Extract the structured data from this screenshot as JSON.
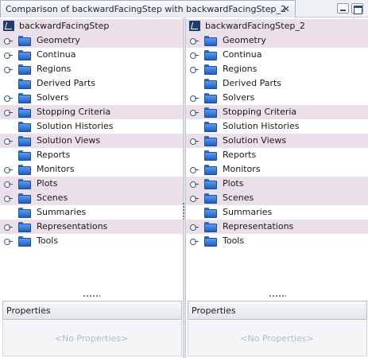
{
  "window": {
    "tab_title": "Comparison of backwardFacingStep with backwardFacingStep_2",
    "close_glyph": "✕"
  },
  "left": {
    "root": "backwardFacingStep",
    "nodes": [
      {
        "label": "Geometry",
        "expandable": true,
        "alt": true
      },
      {
        "label": "Continua",
        "expandable": true,
        "alt": false
      },
      {
        "label": "Regions",
        "expandable": true,
        "alt": false
      },
      {
        "label": "Derived Parts",
        "expandable": false,
        "alt": false
      },
      {
        "label": "Solvers",
        "expandable": true,
        "alt": false
      },
      {
        "label": "Stopping Criteria",
        "expandable": true,
        "alt": true
      },
      {
        "label": "Solution Histories",
        "expandable": false,
        "alt": false
      },
      {
        "label": "Solution Views",
        "expandable": true,
        "alt": true
      },
      {
        "label": "Reports",
        "expandable": false,
        "alt": false
      },
      {
        "label": "Monitors",
        "expandable": true,
        "alt": false
      },
      {
        "label": "Plots",
        "expandable": true,
        "alt": true
      },
      {
        "label": "Scenes",
        "expandable": true,
        "alt": true
      },
      {
        "label": "Summaries",
        "expandable": false,
        "alt": false
      },
      {
        "label": "Representations",
        "expandable": true,
        "alt": true
      },
      {
        "label": "Tools",
        "expandable": true,
        "alt": false
      }
    ],
    "properties_title": "Properties",
    "properties_empty": "<No Properties>"
  },
  "right": {
    "root": "backwardFacingStep_2",
    "nodes": [
      {
        "label": "Geometry",
        "expandable": true,
        "alt": true
      },
      {
        "label": "Continua",
        "expandable": true,
        "alt": false
      },
      {
        "label": "Regions",
        "expandable": true,
        "alt": false
      },
      {
        "label": "Derived Parts",
        "expandable": false,
        "alt": false
      },
      {
        "label": "Solvers",
        "expandable": true,
        "alt": false
      },
      {
        "label": "Stopping Criteria",
        "expandable": true,
        "alt": true
      },
      {
        "label": "Solution Histories",
        "expandable": false,
        "alt": false
      },
      {
        "label": "Solution Views",
        "expandable": true,
        "alt": true
      },
      {
        "label": "Reports",
        "expandable": false,
        "alt": false
      },
      {
        "label": "Monitors",
        "expandable": true,
        "alt": false
      },
      {
        "label": "Plots",
        "expandable": true,
        "alt": true
      },
      {
        "label": "Scenes",
        "expandable": true,
        "alt": true
      },
      {
        "label": "Summaries",
        "expandable": false,
        "alt": false
      },
      {
        "label": "Representations",
        "expandable": true,
        "alt": true
      },
      {
        "label": "Tools",
        "expandable": true,
        "alt": false
      }
    ],
    "properties_title": "Properties",
    "properties_empty": "<No Properties>"
  },
  "colors": {
    "highlight_row": "#ebdfe9",
    "folder_blue": "#2f6fcf",
    "empty_text": "#b5bcc8"
  }
}
